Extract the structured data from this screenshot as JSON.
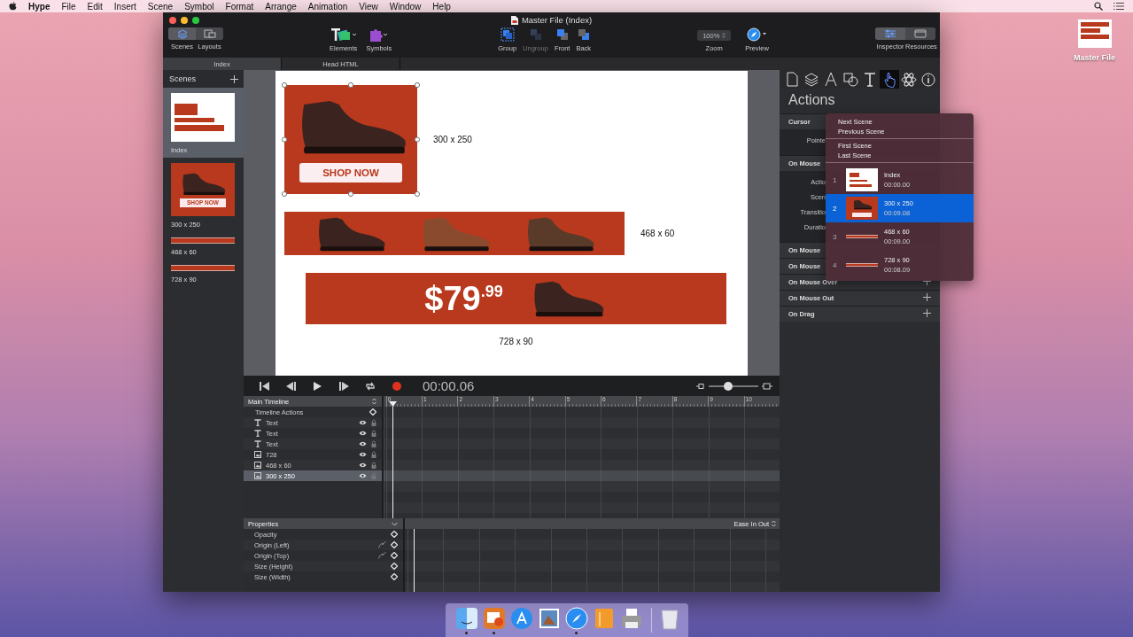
{
  "menu_bar": {
    "app": "Hype",
    "items": [
      "File",
      "Edit",
      "Insert",
      "Scene",
      "Symbol",
      "Format",
      "Arrange",
      "Animation",
      "View",
      "Window",
      "Help"
    ]
  },
  "desktop_icon": {
    "label": "Master File"
  },
  "window": {
    "title": "Master File (Index)"
  },
  "toolbar": {
    "view_modes": [
      {
        "label": "Scenes",
        "selected": true
      },
      {
        "label": "Layouts",
        "selected": false
      }
    ],
    "insert": [
      {
        "label": "Elements",
        "kind": "elements"
      },
      {
        "label": "Symbols",
        "kind": "symbols"
      }
    ],
    "arrange": [
      {
        "label": "Group",
        "kind": "group",
        "disabled": false
      },
      {
        "label": "Ungroup",
        "kind": "ungroup",
        "disabled": true
      },
      {
        "label": "Front",
        "kind": "front",
        "disabled": false
      },
      {
        "label": "Back",
        "kind": "back",
        "disabled": false
      }
    ],
    "zoom": {
      "value": "100%",
      "label": "Zoom"
    },
    "preview": {
      "label": "Preview"
    },
    "panels": [
      {
        "label": "Inspector",
        "selected": true
      },
      {
        "label": "Resources",
        "selected": false
      }
    ]
  },
  "doc_tabs": [
    {
      "label": "Index",
      "selected": true
    },
    {
      "label": "Head HTML",
      "selected": false
    }
  ],
  "scenes_panel": {
    "title": "Scenes",
    "scenes": [
      {
        "name": "Index",
        "kind": "overview",
        "selected": true
      },
      {
        "name": "300 x 250",
        "kind": "square",
        "selected": false,
        "thumbnail_text": "SHOP NOW"
      },
      {
        "name": "468 x 60",
        "kind": "wide",
        "selected": false
      },
      {
        "name": "728 x 90",
        "kind": "leaderboard",
        "selected": false
      }
    ]
  },
  "canvas": {
    "banners": [
      {
        "kind": "square",
        "button": "SHOP NOW",
        "caption": "300 x 250",
        "selected": true
      },
      {
        "kind": "wide",
        "caption": "468 x 60",
        "selected": false
      },
      {
        "kind": "leaderboard",
        "price": "$79",
        "cents": ".99",
        "caption": "728 x 90",
        "selected": false
      }
    ]
  },
  "transport": {
    "time": "00:00.06",
    "level": 0.4
  },
  "timeline": {
    "title": "Main Timeline",
    "actions": "Timeline Actions",
    "ticks": [
      "0",
      "1",
      "2",
      "3",
      "4",
      "5",
      "6",
      "7",
      "8",
      "9",
      "10"
    ],
    "layers": [
      {
        "name": "Text",
        "kind": "text",
        "selected": false
      },
      {
        "name": "Text",
        "kind": "text",
        "selected": false
      },
      {
        "name": "Text",
        "kind": "text",
        "selected": false
      },
      {
        "name": "728",
        "kind": "image",
        "selected": false
      },
      {
        "name": "468 x 60",
        "kind": "image",
        "selected": false
      },
      {
        "name": "300 x 250",
        "kind": "image",
        "selected": true
      }
    ]
  },
  "properties": {
    "title": "Properties",
    "easing": "Ease In Out",
    "items": [
      {
        "name": "Opacity",
        "motion_path": false
      },
      {
        "name": "Origin (Left)",
        "motion_path": true
      },
      {
        "name": "Origin (Top)",
        "motion_path": true
      },
      {
        "name": "Size (Height)",
        "motion_path": false
      },
      {
        "name": "Size (Width)",
        "motion_path": false
      }
    ]
  },
  "inspector": {
    "title": "Actions",
    "tabs": [
      {
        "kind": "document",
        "selected": false
      },
      {
        "kind": "layers",
        "selected": false
      },
      {
        "kind": "pen",
        "selected": false
      },
      {
        "kind": "shapes",
        "selected": false
      },
      {
        "kind": "text",
        "selected": false
      },
      {
        "kind": "hand",
        "selected": true
      },
      {
        "kind": "atom",
        "selected": false
      },
      {
        "kind": "info",
        "selected": false
      }
    ],
    "sections": [
      {
        "label": "Cursor",
        "rows": [
          "Pointe"
        ]
      },
      {
        "label": "On Mouse",
        "rows": [
          "Actio",
          "Scen",
          "Transitio",
          "Duratio"
        ]
      },
      {
        "label": "On Mouse"
      },
      {
        "label": "On Mouse"
      },
      {
        "label": "On Mouse Over",
        "add_button": true
      },
      {
        "label": "On Mouse Out",
        "add_button": true
      },
      {
        "label": "On Drag",
        "add_button": true
      }
    ]
  },
  "scene_menu": {
    "groups": [
      [
        "Next Scene",
        "Previous Scene"
      ],
      [
        "First Scene",
        "Last Scene"
      ]
    ],
    "scenes": [
      {
        "number": "1",
        "name": "Index",
        "time": "00:00.00",
        "kind": "overview",
        "selected": false
      },
      {
        "number": "2",
        "name": "300 x 250",
        "time": "00:09.08",
        "kind": "square",
        "selected": true
      },
      {
        "number": "3",
        "name": "468 x 60",
        "time": "00:09.00",
        "kind": "wide",
        "selected": false
      },
      {
        "number": "4",
        "name": "728 x 90",
        "time": "00:08.09",
        "kind": "leaderboard",
        "selected": false
      }
    ]
  },
  "dock": [
    {
      "kind": "finder",
      "running": true
    },
    {
      "kind": "hype",
      "running": true
    },
    {
      "kind": "store",
      "running": false
    },
    {
      "kind": "photo",
      "running": false
    },
    {
      "kind": "safari",
      "running": true
    },
    {
      "kind": "pages",
      "running": false
    },
    {
      "kind": "printer",
      "running": false
    },
    {
      "kind": "trash",
      "running": false
    }
  ]
}
